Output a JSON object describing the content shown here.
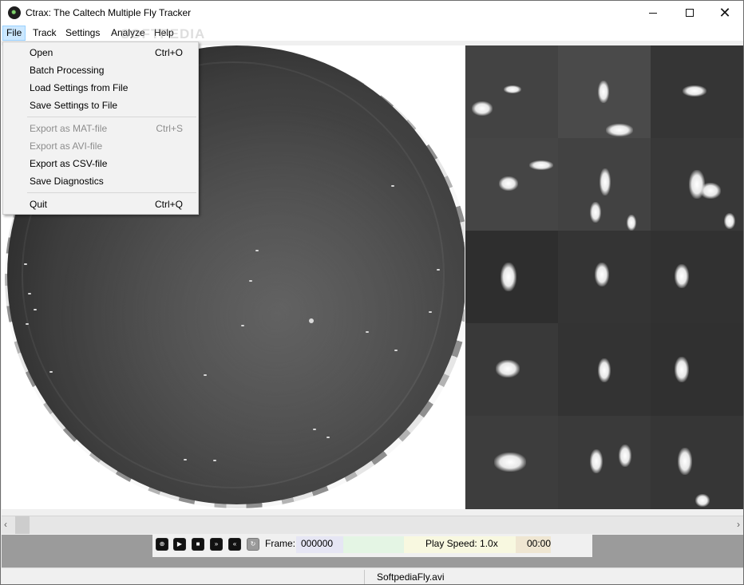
{
  "window": {
    "title": "Ctrax: The Caltech Multiple Fly Tracker",
    "minimize_glyph": "—",
    "close_glyph": "✕"
  },
  "menubar": {
    "items": [
      {
        "label": "File"
      },
      {
        "label": "Track"
      },
      {
        "label": "Settings"
      },
      {
        "label": "Analyze"
      },
      {
        "label": "Help"
      }
    ]
  },
  "file_menu": {
    "items": [
      {
        "label": "Open",
        "shortcut": "Ctrl+O",
        "enabled": true
      },
      {
        "label": "Batch Processing",
        "shortcut": "",
        "enabled": true
      },
      {
        "label": "Load Settings from File",
        "shortcut": "",
        "enabled": true
      },
      {
        "label": "Save Settings to File",
        "shortcut": "",
        "enabled": true
      },
      {
        "label": "Export as MAT-file",
        "shortcut": "Ctrl+S",
        "enabled": false
      },
      {
        "label": "Export as AVI-file",
        "shortcut": "",
        "enabled": false
      },
      {
        "label": "Export as CSV-file",
        "shortcut": "",
        "enabled": true
      },
      {
        "label": "Save Diagnostics",
        "shortcut": "",
        "enabled": true
      },
      {
        "label": "Quit",
        "shortcut": "Ctrl+Q",
        "enabled": true
      }
    ]
  },
  "scrollbar": {
    "left_glyph": "‹",
    "right_glyph": "›"
  },
  "playback": {
    "zoom_glyph": "⊕",
    "play_glyph": "▶",
    "stop_glyph": "■",
    "fast_forward_glyph": "»",
    "rewind_glyph": "«",
    "refresh_glyph": "↻",
    "frame_label": "Frame:",
    "frame_value": "000000",
    "play_speed": "Play Speed: 1.0x",
    "time": "00:00"
  },
  "status": {
    "filename": "SoftpediaFly.avi"
  },
  "watermark": "SOFTPEDIA",
  "icons": [
    "app-icon",
    "zoom-icon",
    "play-icon",
    "stop-icon",
    "fast-forward-icon",
    "rewind-icon",
    "refresh-icon",
    "chevron-left-icon",
    "chevron-right-icon"
  ]
}
